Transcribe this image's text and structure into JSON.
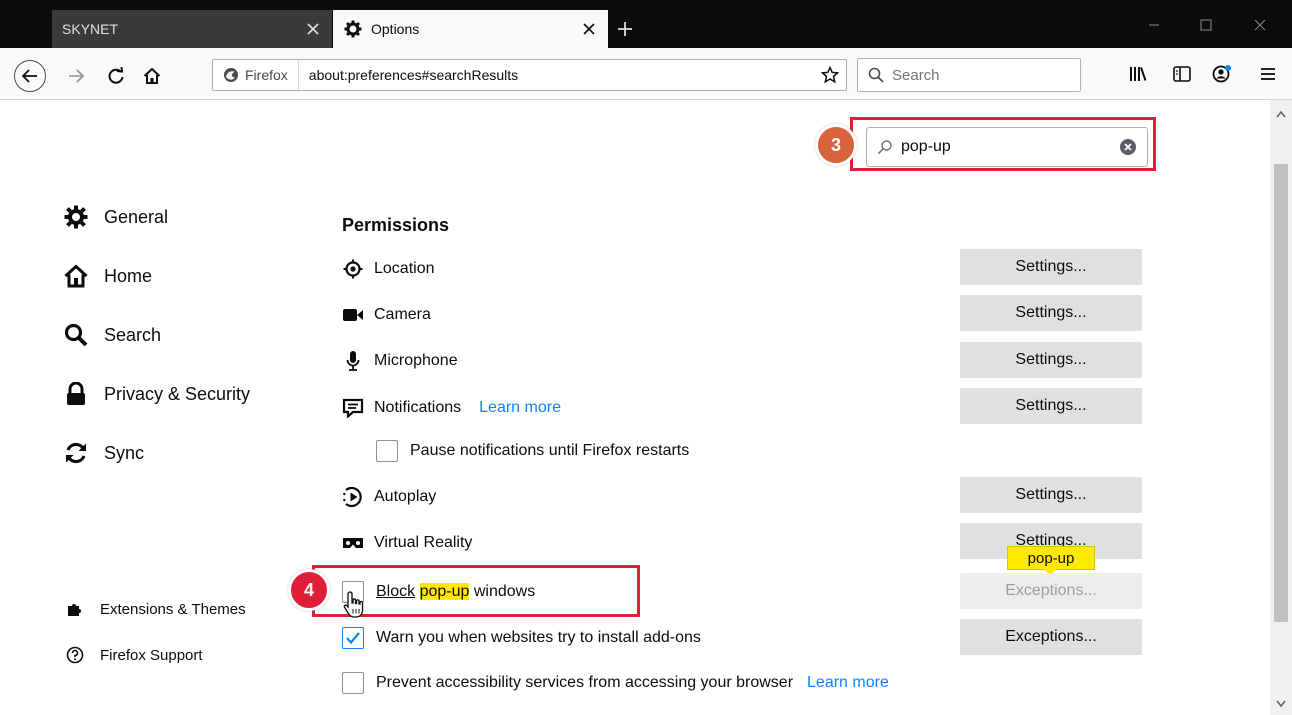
{
  "tabs": [
    {
      "title": "SKYNET",
      "active": false
    },
    {
      "title": "Options",
      "active": true
    }
  ],
  "nav": {
    "identity_label": "Firefox",
    "url": "about:preferences#searchResults",
    "search_placeholder": "Search"
  },
  "prefs_search": {
    "value": "pop-up"
  },
  "steps": {
    "step3": "3",
    "step4": "4"
  },
  "sidebar": {
    "categories": [
      {
        "label": "General",
        "icon": "gear-icon"
      },
      {
        "label": "Home",
        "icon": "home-icon"
      },
      {
        "label": "Search",
        "icon": "search-icon"
      },
      {
        "label": "Privacy & Security",
        "icon": "lock-icon"
      },
      {
        "label": "Sync",
        "icon": "sync-icon"
      }
    ],
    "footer": [
      {
        "label": "Extensions & Themes",
        "icon": "puzzle-icon"
      },
      {
        "label": "Firefox Support",
        "icon": "help-icon"
      }
    ]
  },
  "permissions": {
    "title": "Permissions",
    "rows": [
      {
        "label": "Location",
        "icon": "location-icon",
        "button": "Settings..."
      },
      {
        "label": "Camera",
        "icon": "camera-icon",
        "button": "Settings..."
      },
      {
        "label": "Microphone",
        "icon": "microphone-icon",
        "button": "Settings..."
      },
      {
        "label": "Notifications",
        "icon": "notifications-icon",
        "link": "Learn more",
        "button": "Settings..."
      },
      {
        "label": "Autoplay",
        "icon": "autoplay-icon",
        "button": "Settings..."
      },
      {
        "label": "Virtual Reality",
        "icon": "vr-icon",
        "button": "Settings..."
      }
    ],
    "pause_notifications": {
      "label": "Pause notifications until Firefox restarts",
      "checked": false
    },
    "block_popups": {
      "label_before": "Block",
      "label_highlight": "pop-up",
      "label_after": "windows",
      "checked": false,
      "button": "Exceptions...",
      "button_disabled": true
    },
    "tooltip": "pop-up",
    "warn_addons": {
      "label": "Warn you when websites try to install add-ons",
      "checked": true,
      "button": "Exceptions..."
    },
    "prevent_accessibility": {
      "label": "Prevent accessibility services from accessing your browser",
      "checked": false,
      "link": "Learn more"
    }
  },
  "colors": {
    "accent": "#0a84ff",
    "annotation_red": "#e01e37",
    "badge_orange": "#d9633c",
    "highlight": "#ffe900"
  }
}
